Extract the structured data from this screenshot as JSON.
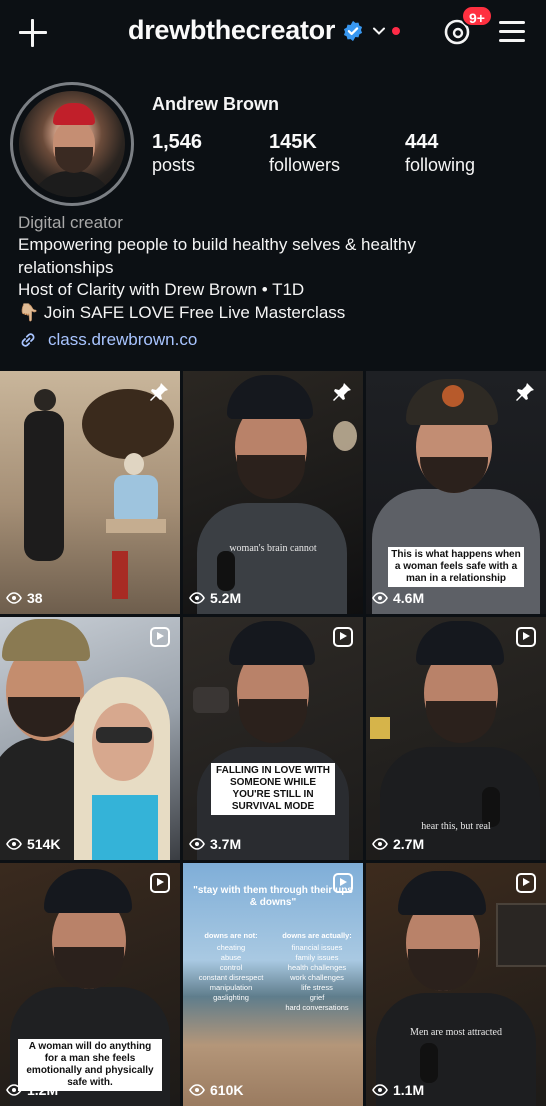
{
  "header": {
    "username": "drewbthecreator",
    "notification_badge": "9+",
    "icons": [
      "plus-icon",
      "verified-icon",
      "chevron-down-icon",
      "threads-icon",
      "menu-icon"
    ]
  },
  "profile": {
    "full_name": "Andrew Brown",
    "stats": [
      {
        "value": "1,546",
        "label": "posts"
      },
      {
        "value": "145K",
        "label": "followers"
      },
      {
        "value": "444",
        "label": "following"
      }
    ],
    "category": "Digital creator",
    "bio_lines": [
      "Empowering people to build healthy selves & healthy",
      "relationships",
      "Host of Clarity with Drew Brown • T1D",
      "👇🏼 Join SAFE LOVE Free Live Masterclass"
    ],
    "link": "class.drewbrown.co"
  },
  "posts": [
    {
      "views": "38",
      "type": "pinned",
      "caption": ""
    },
    {
      "views": "5.2M",
      "type": "pinned",
      "caption": "woman's brain cannot"
    },
    {
      "views": "4.6M",
      "type": "pinned",
      "caption": "This is what happens when a woman feels safe with a man in a relationship"
    },
    {
      "views": "514K",
      "type": "reel",
      "caption": ""
    },
    {
      "views": "3.7M",
      "type": "reel",
      "caption": "FALLING IN LOVE WITH SOMEONE WHILE YOU'RE STILL IN SURVIVAL MODE"
    },
    {
      "views": "2.7M",
      "type": "reel",
      "caption": "hear this, but real"
    },
    {
      "views": "1.2M",
      "type": "reel",
      "caption": "A woman will do anything for a man she feels emotionally and physically safe with."
    },
    {
      "views": "610K",
      "type": "reel",
      "caption": "\"stay with them through their ups & downs\""
    },
    {
      "views": "1.1M",
      "type": "reel",
      "caption": "Men are most attracted"
    }
  ],
  "beach_post": {
    "left_title": "downs are not:",
    "right_title": "downs are actually:",
    "left_items": [
      "cheating",
      "abuse",
      "control",
      "constant disrespect",
      "manipulation",
      "gaslighting"
    ],
    "right_items": [
      "financial issues",
      "family issues",
      "health challenges",
      "work challenges",
      "life stress",
      "grief",
      "hard conversations"
    ]
  },
  "colors": {
    "background": "#0c1014",
    "link": "#a8c4ff",
    "badge": "#ff3040",
    "verified": "#3897f0"
  }
}
